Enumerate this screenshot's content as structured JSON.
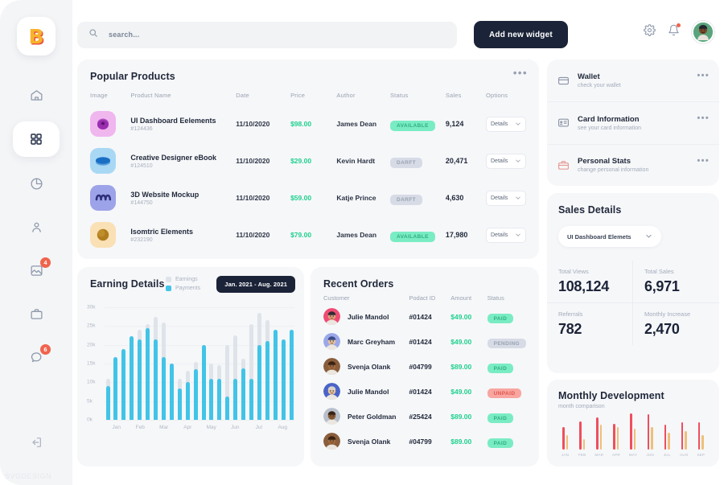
{
  "brand": {
    "logo_letter": "B"
  },
  "sidebar": {
    "items": [
      {
        "name": "home",
        "icon": "home-icon",
        "badge": null,
        "active": false
      },
      {
        "name": "dashboard",
        "icon": "grid-icon",
        "badge": null,
        "active": true
      },
      {
        "name": "analytics",
        "icon": "pie-chart-icon",
        "badge": null,
        "active": false
      },
      {
        "name": "profile",
        "icon": "user-icon",
        "badge": null,
        "active": false
      },
      {
        "name": "media",
        "icon": "image-icon",
        "badge": "4",
        "active": false
      },
      {
        "name": "briefcase",
        "icon": "briefcase-icon",
        "badge": null,
        "active": false
      },
      {
        "name": "messages",
        "icon": "chat-icon",
        "badge": "6",
        "active": false
      }
    ],
    "logout_icon": "logout-icon",
    "watermark": "SVGDESIGN"
  },
  "header": {
    "search_placeholder": "search...",
    "search_value": "",
    "add_widget_label": "Add new widget",
    "settings_icon": "gear-icon",
    "notifications_icon": "bell-icon",
    "avatar": "user-avatar"
  },
  "popular_products": {
    "title": "Popular Products",
    "menu_icon": "more-options-icon",
    "columns": [
      "Image",
      "Product Name",
      "Date",
      "Price",
      "Author",
      "Status",
      "Sales",
      "Options"
    ],
    "rows": [
      {
        "thumb_bg": "#f0b6ee",
        "thumb_fg": "#9b2fb0",
        "thumb_shape": "donut",
        "name": "UI Dashboard Eelements",
        "id": "#124436",
        "date": "11/10/2020",
        "price": "$98.00",
        "author": "James Dean",
        "status": "AVAILABLE",
        "status_kind": "available",
        "sales": "9,124",
        "option_label": "Details"
      },
      {
        "thumb_bg": "#a9d8f5",
        "thumb_fg": "#1a6fc4",
        "thumb_shape": "ellipse",
        "name": "Creative Designer eBook",
        "id": "#124510",
        "date": "11/10/2020",
        "price": "$29.00",
        "author": "Kevin Hardt",
        "status": "DARFT",
        "status_kind": "darft",
        "sales": "20,471",
        "option_label": "Details"
      },
      {
        "thumb_bg": "#9da3e8",
        "thumb_fg": "#2e2f7a",
        "thumb_shape": "coil",
        "name": "3D Website Mockup",
        "id": "#144750",
        "date": "11/10/2020",
        "price": "$59.00",
        "author": "Katje Prince",
        "status": "DARFT",
        "status_kind": "darft",
        "sales": "4,630",
        "option_label": "Details"
      },
      {
        "thumb_bg": "#fae0b5",
        "thumb_fg": "#b07d1e",
        "thumb_shape": "sphere",
        "name": "Isomtric Elements",
        "id": "#232190",
        "date": "11/10/2020",
        "price": "$79.00",
        "author": "James Dean",
        "status": "AVAILABLE",
        "status_kind": "available",
        "sales": "17,980",
        "option_label": "Details"
      }
    ]
  },
  "quick_links": {
    "menu_icon": "more-options-icon",
    "items": [
      {
        "icon": "wallet-icon",
        "icon_color": "#8a94a6",
        "title": "Wallet",
        "subtitle": "check your wallet"
      },
      {
        "icon": "card-icon",
        "icon_color": "#8a94a6",
        "title": "Card Information",
        "subtitle": "see your card information"
      },
      {
        "icon": "briefcase-icon",
        "icon_color": "#e59c94",
        "title": "Personal Stats",
        "subtitle": "change personal information"
      }
    ]
  },
  "sales_details": {
    "title": "Sales Details",
    "select_value": "UI Dashboard Elemets",
    "select_icon": "chevron-down-icon",
    "stats": [
      {
        "label": "Total Views",
        "value": "108,124"
      },
      {
        "label": "Total Sales",
        "value": "6,971"
      },
      {
        "label": "Referrals",
        "value": "782"
      },
      {
        "label": "Monthly Increase",
        "value": "2,470"
      }
    ]
  },
  "earning_details": {
    "title": "Earning Details",
    "date_range": "Jan. 2021 - Aug. 2021",
    "legend": [
      {
        "label": "Earnings",
        "color": "#dfe3ea"
      },
      {
        "label": "Payments",
        "color": "#41c4e8"
      }
    ]
  },
  "recent_orders": {
    "title": "Recent Orders",
    "columns": [
      "Customer",
      "Podact ID",
      "Amount",
      "Status"
    ],
    "rows": [
      {
        "avatar_bg": "#ef4b73",
        "avatar_skin": "#e0a07a",
        "avatar_hair": "#2b2b33",
        "customer": "Julie Mandol",
        "product_id": "#01424",
        "amount": "$49.00",
        "status": "PAID",
        "status_kind": "paid"
      },
      {
        "avatar_bg": "#9aa7e8",
        "avatar_skin": "#e8c4a0",
        "avatar_hair": "#3a4a8a",
        "customer": "Marc Greyham",
        "product_id": "#01424",
        "amount": "$49.00",
        "status": "PENDING",
        "status_kind": "pending"
      },
      {
        "avatar_bg": "#8a5e3c",
        "avatar_skin": "#a06a3c",
        "avatar_hair": "#3a2212",
        "customer": "Svenja Olank",
        "product_id": "#04799",
        "amount": "$89.00",
        "status": "PAID",
        "status_kind": "paid"
      },
      {
        "avatar_bg": "#4a63c8",
        "avatar_skin": "#e8c4a0",
        "avatar_hair": "#d8d2cc",
        "customer": "Julie Mandol",
        "product_id": "#01424",
        "amount": "$49.00",
        "status": "UNPAID",
        "status_kind": "unpaid"
      },
      {
        "avatar_bg": "#b8c0cc",
        "avatar_skin": "#8a5a33",
        "avatar_hair": "#3a2212",
        "customer": "Peter Goldman",
        "product_id": "#25424",
        "amount": "$89.00",
        "status": "PAID",
        "status_kind": "paid"
      },
      {
        "avatar_bg": "#8a5e3c",
        "avatar_skin": "#a06a3c",
        "avatar_hair": "#3a2212",
        "customer": "Svenja Olank",
        "product_id": "#04799",
        "amount": "$89.00",
        "status": "PAID",
        "status_kind": "paid"
      }
    ]
  },
  "monthly_development": {
    "title": "Monthly Development",
    "subtitle": "month comparison"
  },
  "chart_data": [
    {
      "type": "bar",
      "id": "earning-details",
      "title": "Earning Details",
      "annotation": "Jan. 2021 - Aug. 2021",
      "xlabel": "",
      "ylabel": "",
      "ylim": [
        0,
        30000
      ],
      "ytick_labels": [
        "30k",
        "25k",
        "20k",
        "15k",
        "10k",
        "5k",
        "0k"
      ],
      "ytick_values": [
        30000,
        25000,
        20000,
        15000,
        10000,
        5000,
        0
      ],
      "grid": true,
      "legend_position": "top-center",
      "categories": [
        "Jan",
        "Feb",
        "Mar",
        "Apr",
        "May",
        "Jun",
        "Jul",
        "Aug"
      ],
      "bars_per_category": 3,
      "x": [
        "Jan-1",
        "Jan-2",
        "Jan-3",
        "Feb-1",
        "Feb-2",
        "Feb-3",
        "Mar-1",
        "Mar-2",
        "Mar-3",
        "Apr-1",
        "Apr-2",
        "Apr-3",
        "May-1",
        "May-2",
        "May-3",
        "Jun-1",
        "Jun-2",
        "Jun-3",
        "Jul-1",
        "Jul-2",
        "Jul-3",
        "Aug-1",
        "Aug-2",
        "Aug-3"
      ],
      "series": [
        {
          "name": "Earnings",
          "color": "#dfe3ea",
          "values": [
            11000,
            16800,
            18800,
            22200,
            24000,
            25500,
            27500,
            26000,
            15000,
            11000,
            13000,
            15500,
            20000,
            15000,
            14500,
            20000,
            22500,
            16200,
            25500,
            28500,
            26500,
            24000,
            21500,
            24000
          ]
        },
        {
          "name": "Payments",
          "color": "#41c4e8",
          "values": [
            9000,
            16800,
            18800,
            22200,
            21500,
            24500,
            21500,
            16800,
            15000,
            8300,
            10000,
            13500,
            20000,
            11000,
            11000,
            6200,
            11000,
            13800,
            11000,
            20000,
            21000,
            24000,
            21500,
            24000
          ]
        }
      ]
    },
    {
      "type": "bar",
      "id": "monthly-development",
      "title": "Monthly Development",
      "subtitle": "month comparison",
      "grid": false,
      "legend_position": "none",
      "categories": [
        "JAN",
        "FEB",
        "MAR",
        "APR",
        "MAY",
        "JUN",
        "JUL",
        "AUG",
        "SEP"
      ],
      "series": [
        {
          "name": "current",
          "color": "#ef4e5e",
          "values": [
            62,
            78,
            88,
            72,
            100,
            97,
            70,
            75,
            76
          ]
        },
        {
          "name": "previous",
          "color": "#eec07a",
          "values": [
            40,
            28,
            68,
            62,
            58,
            62,
            47,
            52,
            40
          ]
        }
      ],
      "ylim": [
        0,
        100
      ]
    }
  ]
}
